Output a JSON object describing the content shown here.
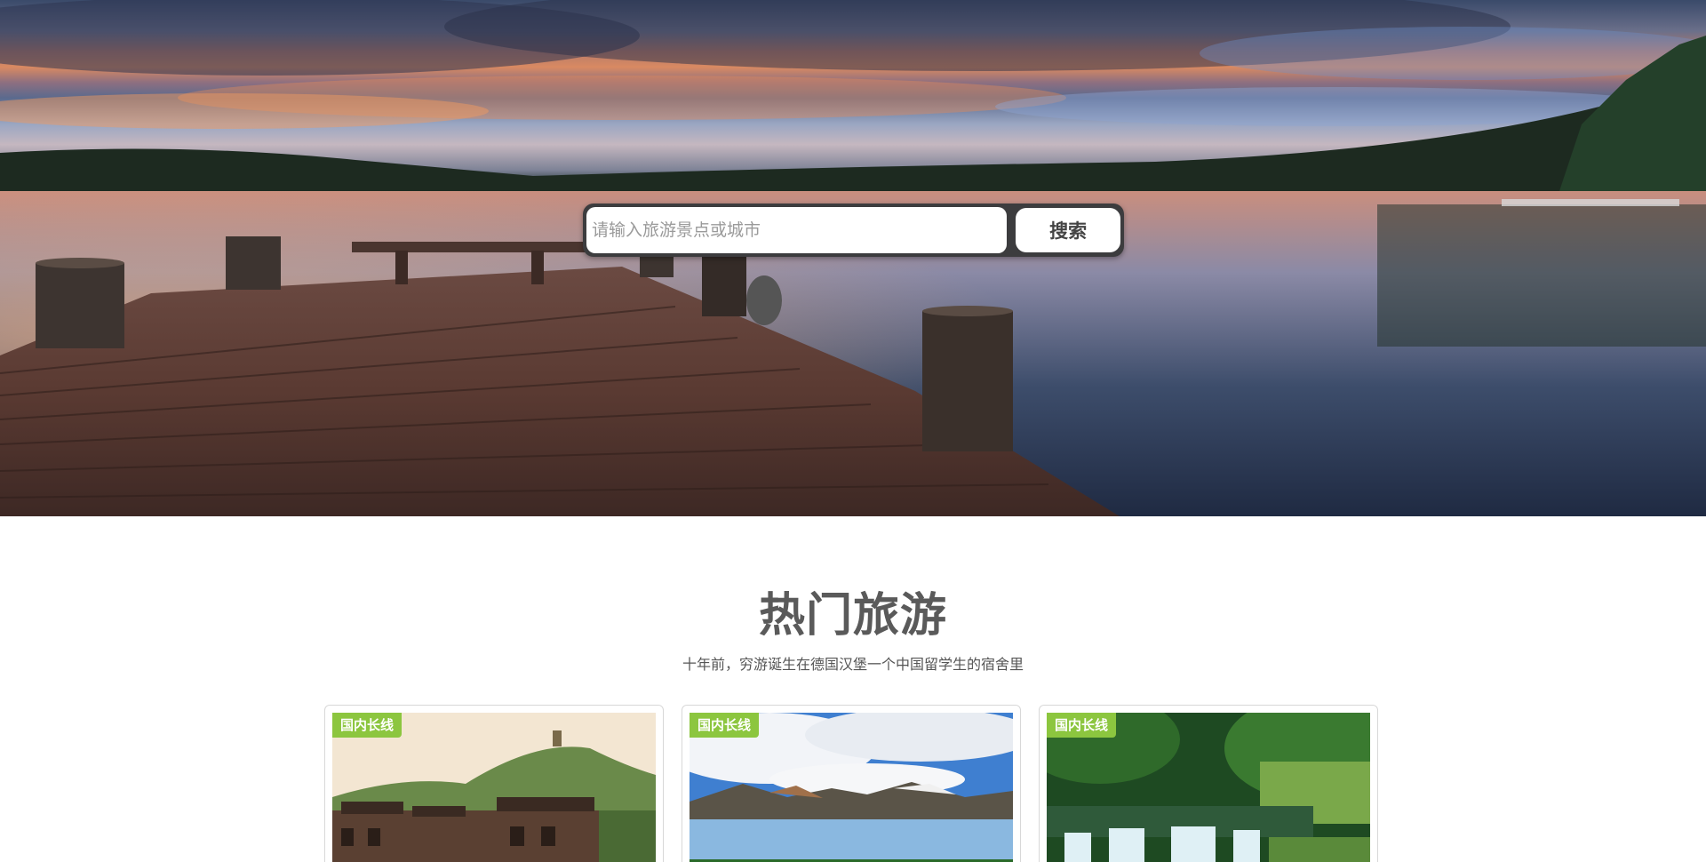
{
  "search": {
    "placeholder": "请输入旅游景点或城市",
    "button_label": "搜索"
  },
  "section": {
    "title": "热门旅游",
    "subtitle": "十年前，穷游诞生在德国汉堡一个中国留学生的宿舍里"
  },
  "cards": [
    {
      "badge": "国内长线"
    },
    {
      "badge": "国内长线"
    },
    {
      "badge": "国内长线"
    }
  ],
  "colors": {
    "badge_green": "#8cc63f",
    "title_gray": "#5a5a5a",
    "search_frame": "#3c3c3e"
  }
}
